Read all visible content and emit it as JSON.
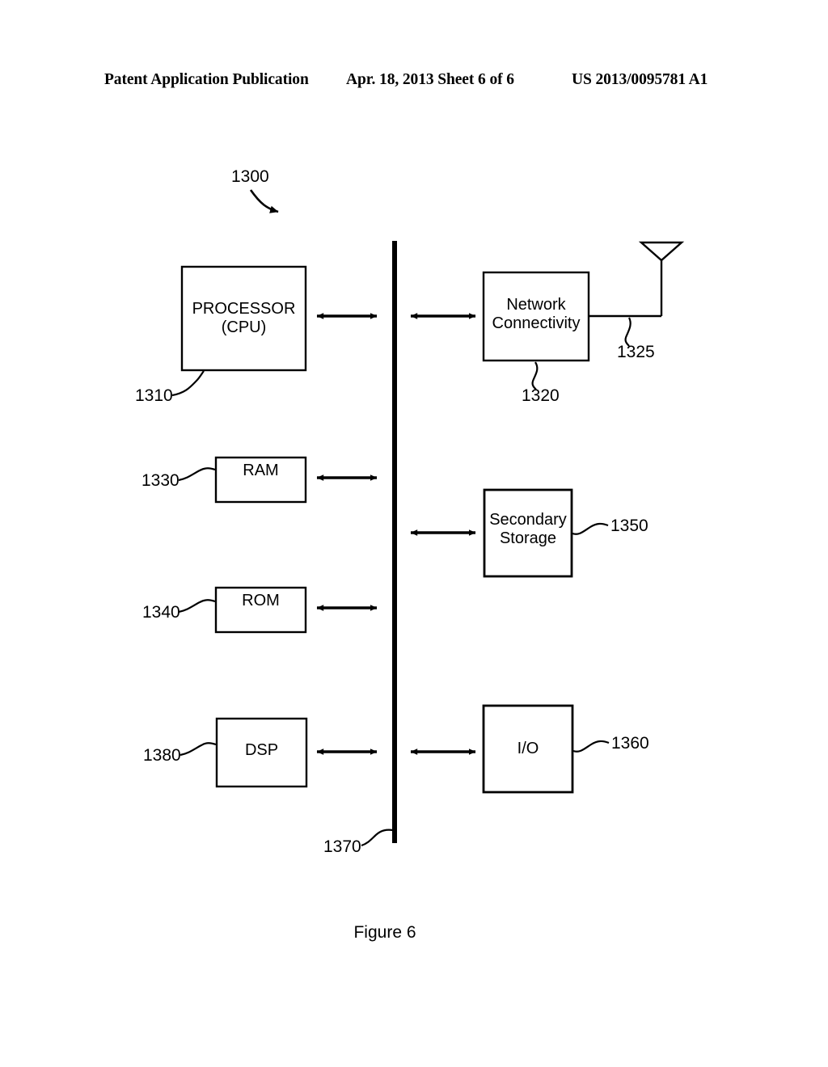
{
  "header": {
    "left": "Patent Application Publication",
    "middle": "Apr. 18, 2013  Sheet 6 of 6",
    "right": "US 2013/0095781 A1"
  },
  "figure": {
    "caption": "Figure 6",
    "system_ref": "1300",
    "blocks": [
      {
        "id": "processor",
        "label_line1": "PROCESSOR",
        "label_line2": "(CPU)",
        "ref": "1310"
      },
      {
        "id": "network",
        "label_line1": "Network",
        "label_line2": "Connectivity",
        "ref": "1320"
      },
      {
        "id": "antenna",
        "label_line1": "",
        "label_line2": "",
        "ref": "1325"
      },
      {
        "id": "ram",
        "label_line1": "RAM",
        "label_line2": "",
        "ref": "1330"
      },
      {
        "id": "rom",
        "label_line1": "ROM",
        "label_line2": "",
        "ref": "1340"
      },
      {
        "id": "secondary-storage",
        "label_line1": "Secondary",
        "label_line2": "Storage",
        "ref": "1350"
      },
      {
        "id": "io",
        "label_line1": "I/O",
        "label_line2": "",
        "ref": "1360"
      },
      {
        "id": "bus",
        "label_line1": "",
        "label_line2": "",
        "ref": "1370"
      },
      {
        "id": "dsp",
        "label_line1": "DSP",
        "label_line2": "",
        "ref": "1380"
      }
    ],
    "colors": {
      "ink": "#000000",
      "paper": "#ffffff"
    }
  }
}
